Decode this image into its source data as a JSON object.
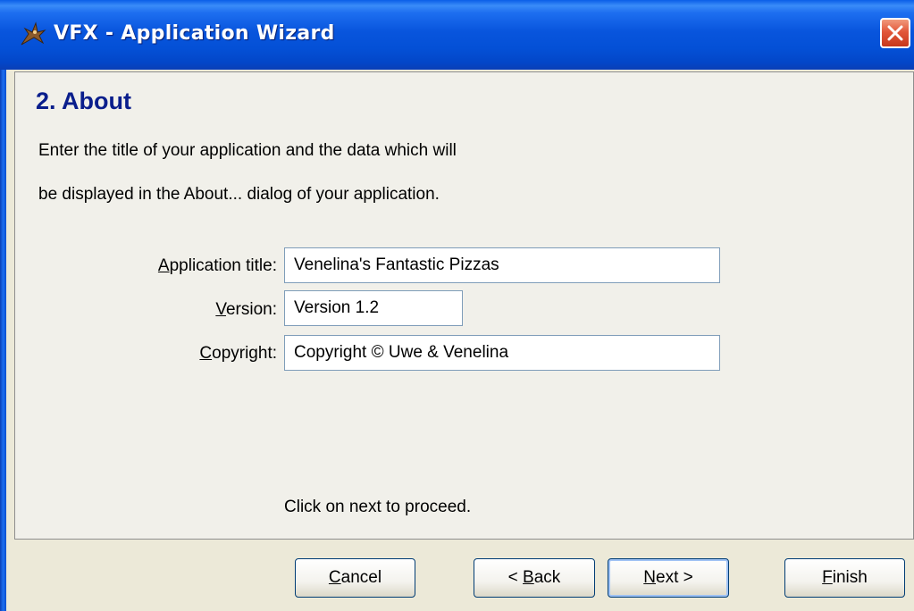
{
  "window": {
    "title": "VFX - Application Wizard"
  },
  "step": {
    "heading": "2. About",
    "description_line1": "Enter the title of your application and the data which will",
    "description_line2": "be displayed in the About... dialog of your application."
  },
  "form": {
    "app_title": {
      "label_mnemonic": "A",
      "label_rest": "pplication title:",
      "value": "Venelina's Fantastic Pizzas"
    },
    "version": {
      "label_mnemonic": "V",
      "label_rest": "ersion:",
      "value": "Version 1.2"
    },
    "copyright": {
      "label_mnemonic": "C",
      "label_rest": "opyright:",
      "value": "Copyright © Uwe & Venelina"
    }
  },
  "hint": "Click on next to proceed.",
  "buttons": {
    "cancel": {
      "mnemonic": "C",
      "rest": "ancel"
    },
    "back": {
      "prefix": "< ",
      "mnemonic": "B",
      "rest": "ack"
    },
    "next": {
      "mnemonic": "N",
      "rest": "ext >"
    },
    "finish": {
      "mnemonic": "F",
      "rest": "inish"
    }
  },
  "icons": {
    "app": "vfx-app-icon",
    "close": "close-icon"
  },
  "colors": {
    "heading": "#0A1E8C",
    "titlebar": "#0450D6",
    "close": "#E2573A",
    "background": "#ECE9D8"
  }
}
